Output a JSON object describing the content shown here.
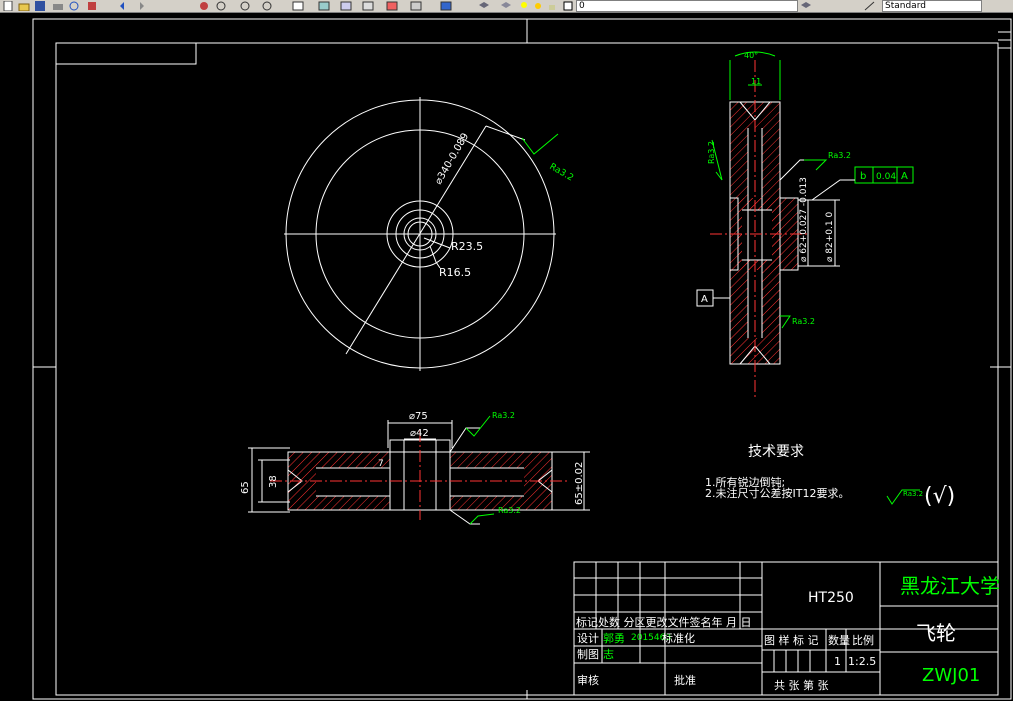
{
  "toolbar": {
    "layer_value": "0",
    "style_value": "Standard",
    "icons": [
      "new-icon",
      "open-icon",
      "save-icon",
      "print-icon",
      "preview-icon",
      "plot-icon",
      "undo-icon",
      "redo-icon",
      "pan-icon",
      "zoom-realtime-icon",
      "zoom-window-icon",
      "zoom-previous-icon",
      "properties-icon",
      "design-center-icon",
      "tool-palette-icon",
      "sheet-set-icon",
      "markup-icon",
      "calc-icon",
      "help-icon",
      "layer-manager-icon",
      "layer-state-icon",
      "bulb-icon",
      "sun-icon",
      "lock-icon",
      "color-square-icon",
      "match-prop-icon",
      "text-style-icon"
    ]
  },
  "drawing": {
    "top_view": {
      "dim_diameter": "⌀340-0.089",
      "r1": "R23.5",
      "r2": "R16.5",
      "roughness": "Ra3.2"
    },
    "side_view": {
      "angle": "40°",
      "groove": "11",
      "ra_left": "Ra3.2",
      "ra_right_top": "Ra3.2",
      "ra_right_bottom": "Ra3.2",
      "tol_symbol": "b",
      "tol_value": "0.04",
      "tol_datum": "A",
      "datum_label": "A",
      "dim_bore": "⌀ 62+0.027 -0.013",
      "dim_hub": "⌀ 82+0.1 0"
    },
    "section_view": {
      "dim_75": "⌀75",
      "dim_42": "⌀42",
      "dim_7": "7",
      "dim_65": "65",
      "dim_38": "38",
      "dim_tol": "65±0.02",
      "ra_top": "Ra3.2",
      "ra_bottom": "Ra3.2"
    },
    "notes": {
      "title": "技术要求",
      "line1": "1.所有锐边倒钝;",
      "line2": "2.未注尺寸公差按IT12要求。",
      "ra_general": "Ra3.2",
      "paren": "(√)"
    },
    "title_block": {
      "material": "HT250",
      "university": "黑龙江大学",
      "part_name": "飞轮",
      "drawing_no": "ZWJ01",
      "revision_row": "标记处数 分区更改文件签名年 月 日",
      "design_label": "设计",
      "designer": "郭勇",
      "design_date": "2015463",
      "standardize": "标准化",
      "draw_label": "制图",
      "drawer": "志",
      "review_label": "审核",
      "approve_label": "批准",
      "stage_header": "图 样 标 记",
      "weight_header": "数量",
      "scale_header": "比例",
      "weight_value": "1",
      "scale_value": "1:2.5",
      "sheet_row": "共  张 第  张"
    }
  }
}
